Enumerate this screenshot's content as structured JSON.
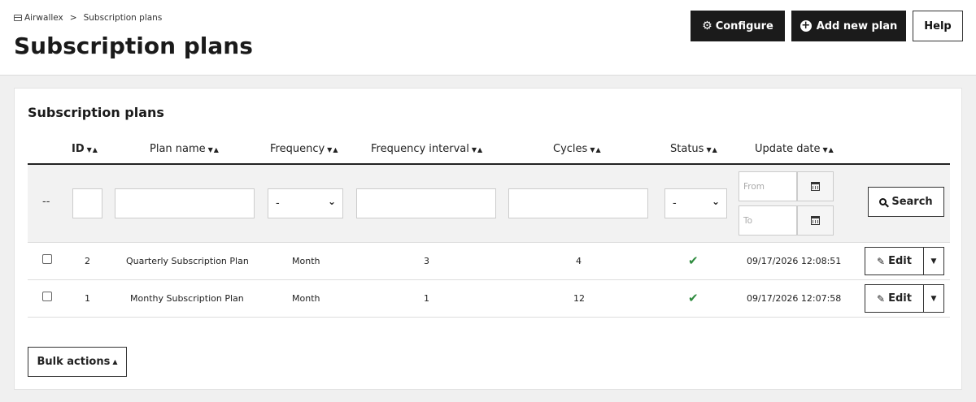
{
  "breadcrumb": {
    "root": "Airwallex",
    "separator": ">",
    "current": "Subscription plans"
  },
  "page_title": "Subscription plans",
  "header_buttons": {
    "configure": "Configure",
    "add_new_plan": "Add new plan",
    "help": "Help"
  },
  "card": {
    "title": "Subscription plans",
    "columns": {
      "id": "ID",
      "plan_name": "Plan name",
      "frequency": "Frequency",
      "frequency_interval": "Frequency interval",
      "cycles": "Cycles",
      "status": "Status",
      "update_date": "Update date"
    },
    "filters": {
      "empty_marker": "--",
      "frequency_selected": "-",
      "status_selected": "-",
      "date_from_placeholder": "From",
      "date_to_placeholder": "To",
      "search_label": "Search"
    },
    "rows": [
      {
        "id": "2",
        "plan_name": "Quarterly Subscription Plan",
        "frequency": "Month",
        "frequency_interval": "3",
        "cycles": "4",
        "status": "active",
        "update_date": "09/17/2026 12:08:51",
        "edit_label": "Edit"
      },
      {
        "id": "1",
        "plan_name": "Monthy Subscription Plan",
        "frequency": "Month",
        "frequency_interval": "1",
        "cycles": "12",
        "status": "active",
        "update_date": "09/17/2026 12:07:58",
        "edit_label": "Edit"
      }
    ],
    "bulk_actions": "Bulk actions"
  },
  "colors": {
    "primary_dark": "#1b1b1b",
    "status_active": "#2e8b3e",
    "page_background": "#f0f0f0"
  },
  "icons": {
    "breadcrumb": "window-icon",
    "configure": "gears-icon",
    "add": "plus-circle-icon",
    "sort": "sort-down-up-icon",
    "calendar": "calendar-icon",
    "search": "search-icon",
    "status": "check-icon",
    "edit": "pencil-icon",
    "dropdown": "caret-down-icon"
  }
}
